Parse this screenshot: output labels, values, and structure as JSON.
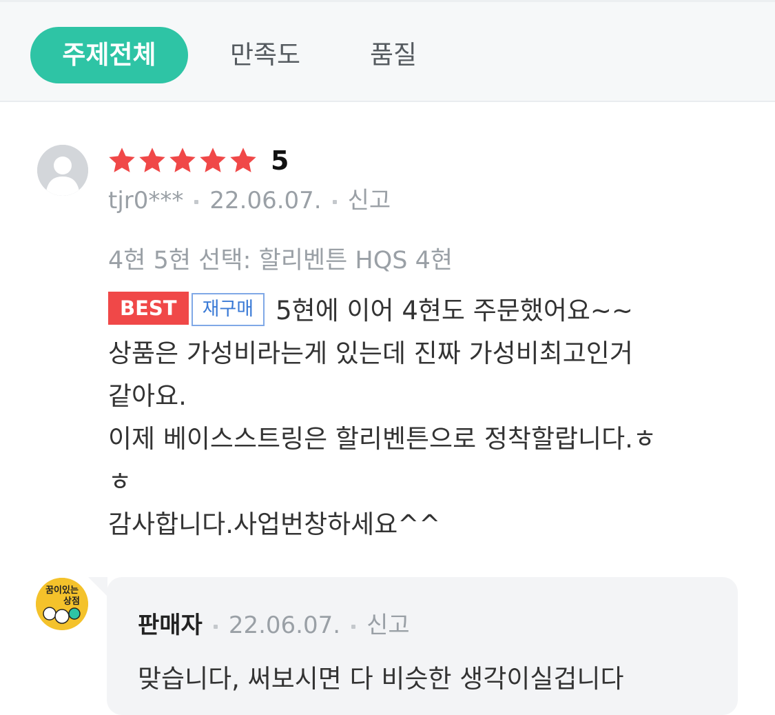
{
  "tabs": [
    {
      "label": "주제전체",
      "active": true
    },
    {
      "label": "만족도",
      "active": false
    },
    {
      "label": "품질",
      "active": false
    }
  ],
  "review": {
    "rating": "5",
    "stars": 5,
    "user": "tjr0***",
    "date": "22.06.07.",
    "report": "신고",
    "option": "4현 5현 선택: 할리벤튼 HQS 4현",
    "badge_best": "BEST",
    "badge_repurchase": "재구매",
    "lines": [
      "5현에 이어 4현도 주문했어요~~",
      "상품은 가성비라는게 있는데 진짜 가성비최고인거",
      "같아요.",
      "이제 베이스스트링은 할리벤튼으로 정착할랍니다.ㅎ",
      "ㅎ",
      "감사합니다.사업번창하세요^^"
    ]
  },
  "reply": {
    "seller": "판매자",
    "date": "22.06.07.",
    "report": "신고",
    "text": "맞습니다, 써보시면 다 비슷한 생각이실겁니다",
    "logo_text_1": "꿈이있는",
    "logo_text_2": "상점"
  },
  "colors": {
    "accent": "#2ec4a5",
    "star": "#f04848",
    "best_badge": "#f04848",
    "repurchase_badge": "#3a7ad6"
  }
}
